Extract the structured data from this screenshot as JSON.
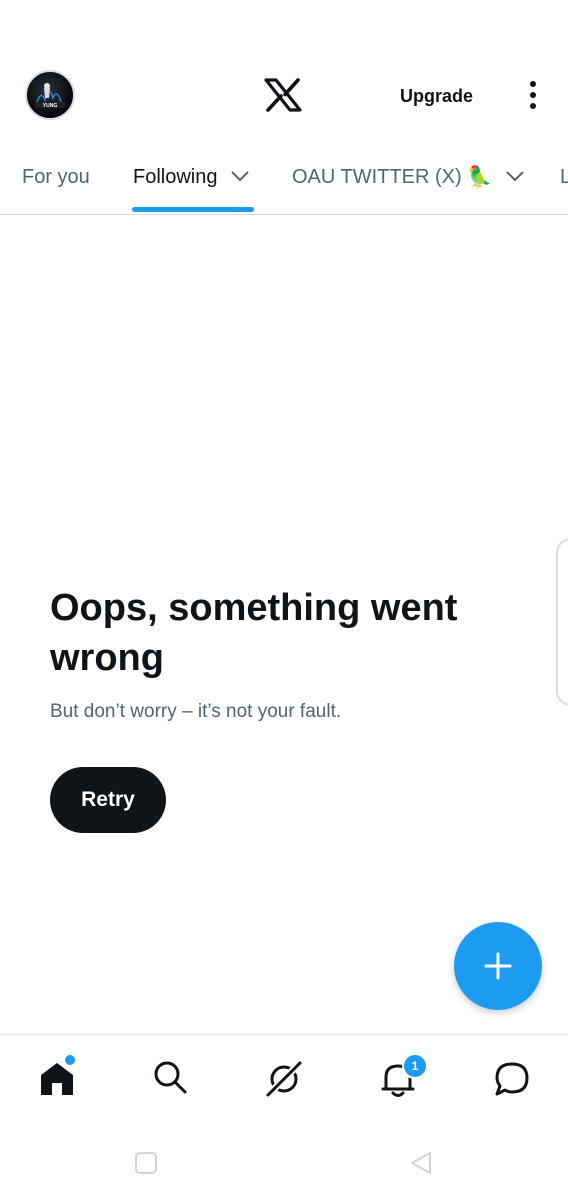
{
  "header": {
    "avatar_text": "YUNG",
    "logo": "x-logo",
    "upgrade_label": "Upgrade",
    "more_icon": "more-vertical-icon"
  },
  "tabs": [
    {
      "label": "For you",
      "active": false
    },
    {
      "label": "Following",
      "active": true,
      "has_dropdown": true
    },
    {
      "label": "OAU TWITTER (X) 🦜",
      "active": false,
      "has_dropdown": true
    },
    {
      "label": "L",
      "active": false
    }
  ],
  "error": {
    "title": "Oops, something went wrong",
    "subtitle": "But don’t worry – it’s not your fault.",
    "retry_label": "Retry"
  },
  "fab": {
    "icon": "plus-icon"
  },
  "bottom_nav": {
    "items": [
      {
        "icon": "home-icon",
        "active": true,
        "dot": true
      },
      {
        "icon": "search-icon"
      },
      {
        "icon": "grok-icon"
      },
      {
        "icon": "bell-icon",
        "badge": "1"
      },
      {
        "icon": "messages-icon"
      }
    ]
  },
  "colors": {
    "accent": "#1d9bf0",
    "text_primary": "#0f1419",
    "text_secondary": "#536471",
    "divider": "#cfd9de"
  }
}
